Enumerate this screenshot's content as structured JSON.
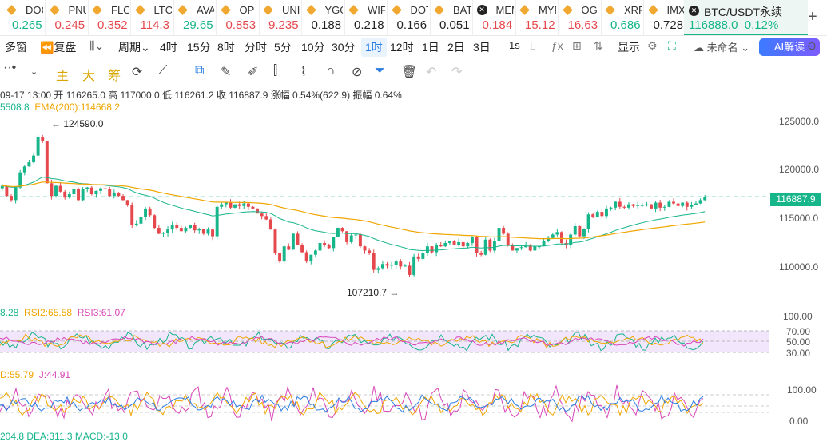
{
  "ticker": [
    {
      "sym": "DOGE",
      "price": "0.265",
      "dir": "up",
      "icon": "diamond-icon"
    },
    {
      "sym": "PNUT",
      "price": "0.245",
      "dir": "dn",
      "icon": "diamond-icon"
    },
    {
      "sym": "FLOKI",
      "price": "0.352",
      "dir": "dn",
      "icon": "diamond-icon"
    },
    {
      "sym": "LTC",
      "price": "114.3",
      "dir": "dn",
      "icon": "diamond-icon"
    },
    {
      "sym": "AVAX",
      "price": "29.65",
      "dir": "up",
      "icon": "diamond-icon"
    },
    {
      "sym": "OP",
      "price": "0.853",
      "dir": "dn",
      "icon": "diamond-icon"
    },
    {
      "sym": "UNI",
      "price": "9.235",
      "dir": "dn",
      "icon": "diamond-icon"
    },
    {
      "sym": "YGG",
      "price": "0.188",
      "dir": "nt",
      "icon": "diamond-icon"
    },
    {
      "sym": "WIF",
      "price": "0.218",
      "dir": "nt",
      "icon": "diamond-icon"
    },
    {
      "sym": "DOT",
      "price": "0.166",
      "dir": "nt",
      "icon": "diamond-icon"
    },
    {
      "sym": "BAT",
      "price": "0.051",
      "dir": "nt",
      "icon": "diamond-icon"
    },
    {
      "sym": "MEME",
      "price": "0.184",
      "dir": "dn",
      "icon": "x-icon"
    },
    {
      "sym": "MYRO",
      "price": "15.12",
      "dir": "dn",
      "icon": "diamond-icon"
    },
    {
      "sym": "OG",
      "price": "16.63",
      "dir": "dn",
      "icon": "diamond-icon"
    },
    {
      "sym": "XRP",
      "price": "0.686",
      "dir": "up",
      "icon": "diamond-icon"
    },
    {
      "sym": "IMX",
      "price": "0.728",
      "dir": "nt",
      "icon": "diamond-icon"
    }
  ],
  "active": {
    "sym": "BTC/USDT永续",
    "price": "116888.0",
    "change": "0.12%"
  },
  "toolbar1": {
    "multi_window": "多窗",
    "replay": "复盘",
    "period": "周期",
    "intervals": [
      "4时",
      "15分",
      "8时",
      "分时",
      "5分",
      "10分",
      "30分",
      "1时",
      "12时",
      "1日",
      "2日",
      "3日"
    ],
    "selected": "1时",
    "sec": "1s",
    "display": "显示",
    "unnamed": "未命名",
    "ai": "AI解读"
  },
  "toolbar2": {
    "cn1": "主",
    "cn2": "大",
    "cn3": "筹"
  },
  "ohlc": "09-17 13:00  开 116265.0  高 117000.0  低 116261.2  收 116887.9  涨幅 0.54%(622.9)  振幅 0.64%",
  "ema_text": {
    "a": "5508.8",
    "b": "EMA(200):114668.2"
  },
  "annot": {
    "high": "← 124590.0",
    "low": "107210.7 →"
  },
  "last_price": "116887.9",
  "rsi_text": {
    "a": "8.28",
    "b": "RSI2:65.58",
    "c": "RSI3:61.07"
  },
  "kdj_text": {
    "a": "D:55.79",
    "b": "J:44.91"
  },
  "macd_text": "204.8  DEA:311.3  MACD:-13.0",
  "price_axis": [
    "125000.0",
    "120000.0",
    "115000.0",
    "110000.0"
  ],
  "rsi_axis": [
    "100.00",
    "70.00",
    "50.00",
    "30.00"
  ],
  "kdj_axis": [
    "100.00",
    "0.00"
  ],
  "colors": {
    "up": "#17b58a",
    "down": "#e5484d",
    "ema_fast": "#17b58a",
    "ema_slow": "#f0a600",
    "rsi1": "#17b58a",
    "rsi2": "#f0a600",
    "rsi3": "#d946b8"
  },
  "chart_data": {
    "type": "candlestick",
    "ylim": [
      105500,
      127000
    ],
    "close": [
      118200,
      117000,
      116500,
      118000,
      119800,
      120500,
      121000,
      121800,
      124000,
      123500,
      118500,
      117000,
      118200,
      117500,
      116800,
      117200,
      117800,
      116500,
      117800,
      118000,
      117200,
      117600,
      117900,
      117800,
      117000,
      117400,
      117000,
      116500,
      115900,
      113500,
      113700,
      114500,
      115500,
      114700,
      113200,
      112500,
      112600,
      113000,
      113500,
      113200,
      112800,
      113200,
      113500,
      112900,
      113100,
      112500,
      113000,
      112200,
      115700,
      116000,
      116200,
      115600,
      116000,
      115800,
      116100,
      115700,
      115500,
      114900,
      114600,
      114200,
      113000,
      110200,
      109200,
      111000,
      110600,
      112500,
      111200,
      110300,
      109200,
      110000,
      110500,
      111400,
      111200,
      110800,
      112100,
      113200,
      112800,
      111500,
      112300,
      112400,
      111000,
      110500,
      110200,
      108200,
      108400,
      108900,
      108700,
      108800,
      109200,
      108600,
      108700,
      107600,
      109800,
      109500,
      110200,
      111000,
      110300,
      111200,
      111000,
      111400,
      111600,
      111200,
      111500,
      111000,
      111400,
      112100,
      110200,
      110000,
      111800,
      110500,
      111600,
      113200,
      112500,
      111200,
      110500,
      110800,
      110900,
      111100,
      110500,
      111000,
      111000,
      111600,
      112000,
      112400,
      112700,
      111400,
      111200,
      112400,
      113400,
      112200,
      113100,
      114800,
      114500,
      115100,
      114600,
      115500,
      115600,
      116300,
      115700,
      115600,
      116000,
      115800,
      115900,
      115900,
      116000,
      115500,
      116200,
      115600,
      115700,
      116300,
      116100,
      115800,
      116200,
      115700,
      115900,
      116100,
      116500,
      116888
    ]
  }
}
